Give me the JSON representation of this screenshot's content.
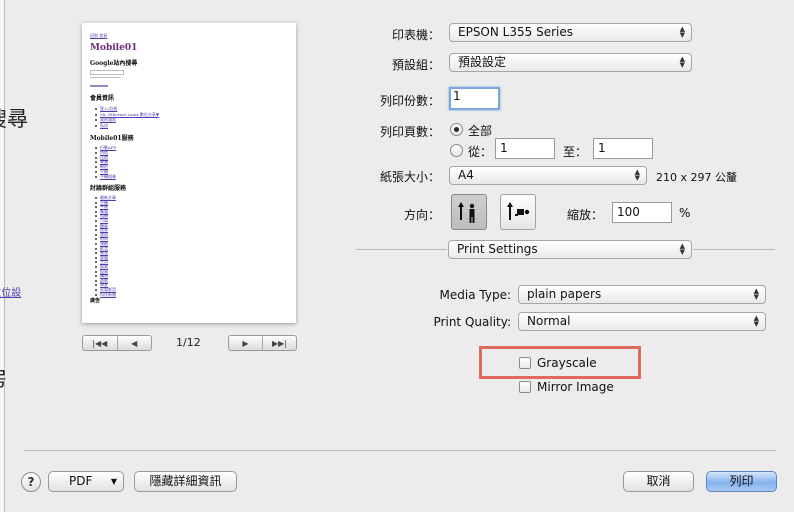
{
  "background_page": {
    "fragments": [
      {
        "text": "搜尋"
      },
      {
        "text": "ux 數位設"
      },
      {
        "text": "房"
      }
    ]
  },
  "preview": {
    "top_link": "回到 首頁",
    "site_title": "Mobile01",
    "search_heading": "Google站內搜尋",
    "member_heading": "會員資訊",
    "member_items": [
      "登入/註冊",
      "Mr. Ethernet Linux 數位分享▼",
      "我的通知",
      "私訊"
    ],
    "services_heading": "Mobile01服務",
    "services_items": [
      "行動APP",
      "特價",
      "比價",
      "專業",
      "網拍",
      "手機",
      "手機搜尋"
    ],
    "forum_heading": "討論群組服務",
    "forum_items": [
      "最新文章",
      "手機",
      "平板",
      "筆電",
      "相機",
      "汽車",
      "機車",
      "居家",
      "旅遊",
      "時尚",
      "運動",
      "影音",
      "美食",
      "電腦",
      "生活",
      "娛樂",
      "投資",
      "購物",
      "遊戲",
      "車友",
      "家電影音",
      "科技新聞"
    ],
    "ad_label": "廣告",
    "page_indicator": "1/12",
    "pager_left": [
      "|◀◀",
      "◀"
    ],
    "pager_right": [
      "▶",
      "▶▶|"
    ]
  },
  "printer": {
    "label": "印表機：",
    "value": "EPSON L355 Series"
  },
  "presets": {
    "label": "預設組：",
    "value": "預設設定"
  },
  "copies": {
    "label": "列印份數：",
    "value": "1"
  },
  "pages": {
    "label": "列印頁數：",
    "all_label": "全部",
    "from_label": "從：",
    "from_value": "1",
    "to_label": "至：",
    "to_value": "1"
  },
  "paper_size": {
    "label": "紙張大小：",
    "value": "A4",
    "dimensions": "210 x 297 公釐"
  },
  "orientation": {
    "label": "方向："
  },
  "scale": {
    "label": "縮放：",
    "value": "100",
    "unit": "%"
  },
  "section_popup": {
    "value": "Print Settings"
  },
  "media_type": {
    "label": "Media Type:",
    "value": "plain papers"
  },
  "print_quality": {
    "label": "Print Quality:",
    "value": "Normal"
  },
  "grayscale": {
    "label": "Grayscale",
    "checked": false
  },
  "mirror": {
    "label": "Mirror Image",
    "checked": false
  },
  "footer": {
    "help": "?",
    "pdf": "PDF",
    "hide_details": "隱藏詳細資訊",
    "cancel": "取消",
    "print": "列印"
  },
  "colors": {
    "highlight": "#e06a62",
    "default_button": "#86b2ec",
    "focus_ring": "#7aa7e0",
    "preview_link": "#4a3fb0"
  }
}
